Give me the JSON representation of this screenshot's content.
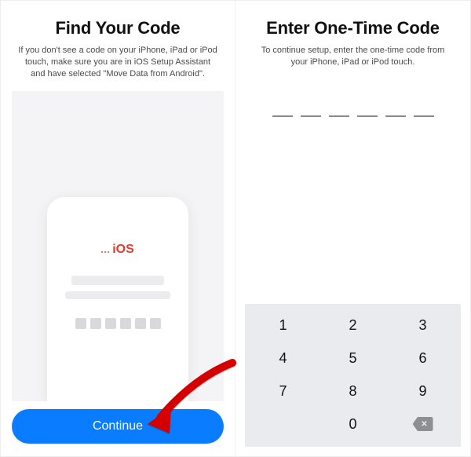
{
  "left": {
    "title": "Find Your Code",
    "subtitle": "If you don't see a code on your iPhone, iPad or iPod touch, make sure you are in iOS Setup Assistant and have selected \"Move Data from Android\".",
    "ios_brand": "iOS",
    "continue_label": "Continue"
  },
  "right": {
    "title": "Enter One-Time Code",
    "subtitle": "To continue setup, enter the one-time code from your iPhone, iPad or iPod touch.",
    "code_slots": 6
  },
  "keypad": {
    "keys": [
      "1",
      "2",
      "3",
      "4",
      "5",
      "6",
      "7",
      "8",
      "9",
      "",
      "0",
      "backspace"
    ]
  },
  "colors": {
    "accent": "#0a7cff",
    "brand_red": "#e63b2e",
    "keypad_bg": "#e9ebef"
  }
}
